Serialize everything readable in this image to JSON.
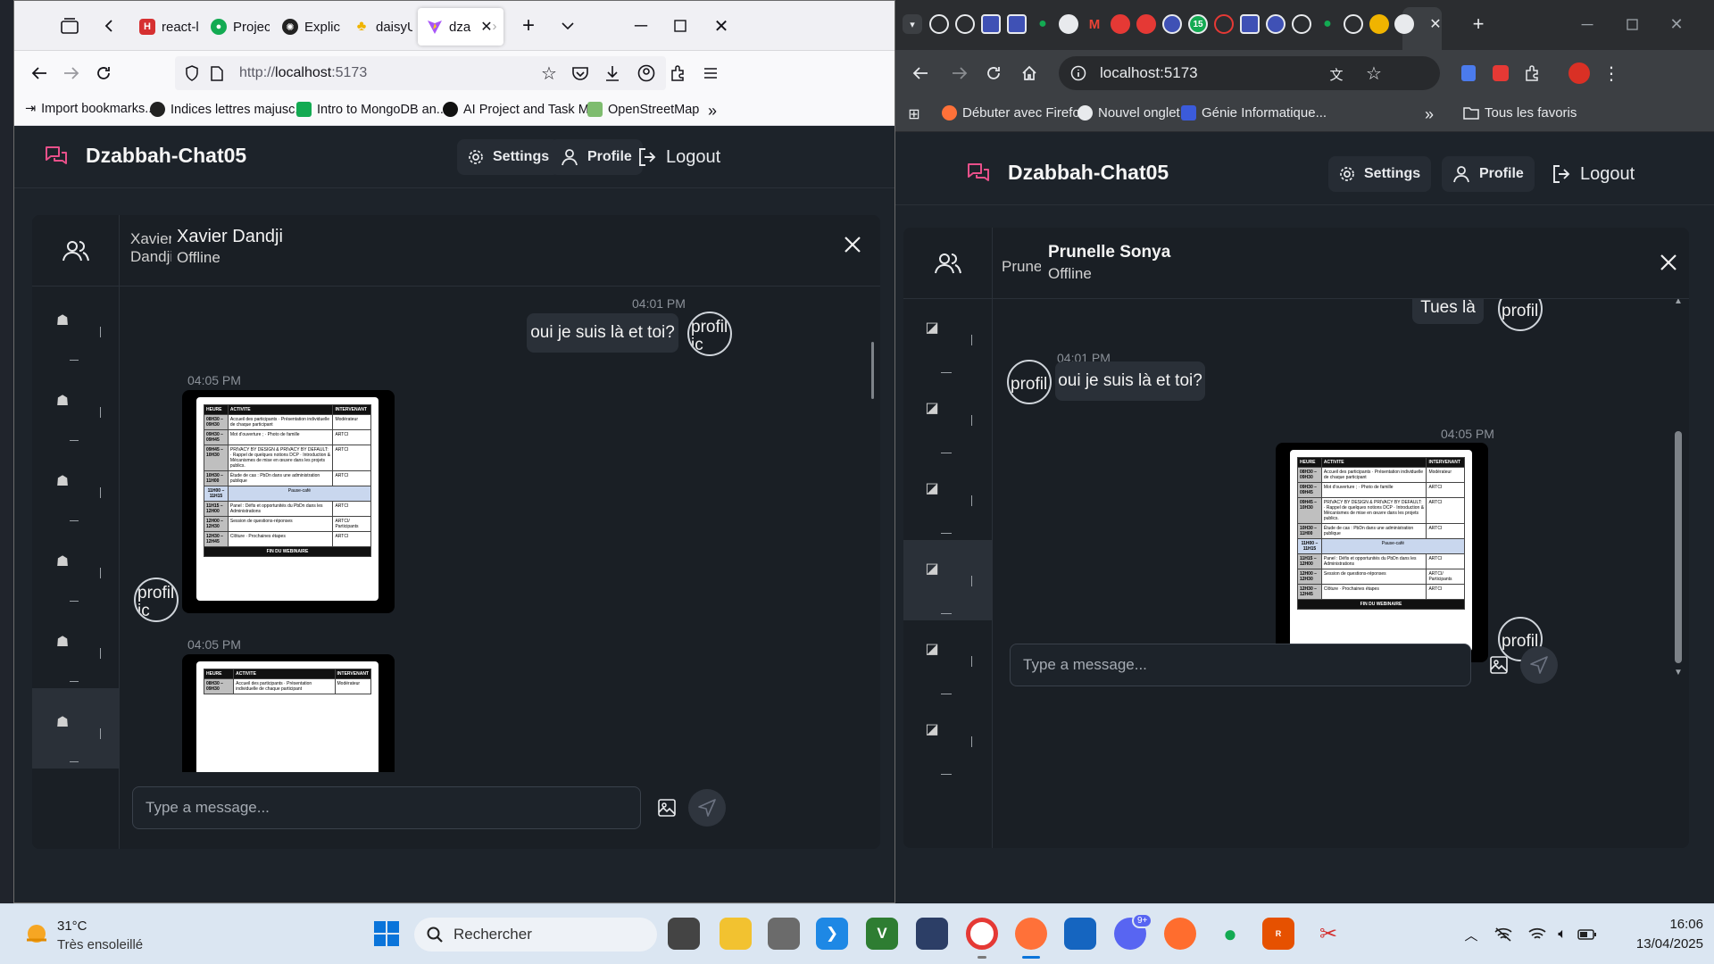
{
  "left_browser": {
    "tabs": [
      {
        "label": "react-l",
        "icon": "H"
      },
      {
        "label": "Projec",
        "icon": "mongodb-leaf"
      },
      {
        "label": "Explic",
        "icon": "openai"
      },
      {
        "label": "daisyU",
        "icon": "daisy"
      },
      {
        "label": "dza",
        "icon": "vite"
      }
    ],
    "url_prefix": "http://",
    "url_host": "localhost",
    "url_port": ":5173",
    "bookmarks": [
      "Import bookmarks...",
      "Indices lettres majusc...",
      "Intro to MongoDB an...",
      "AI Project and Task M...",
      "OpenStreetMap"
    ]
  },
  "right_browser": {
    "url": "localhost:5173",
    "bookmarks": [
      "Débuter avec Firefox",
      "Nouvel onglet",
      "Génie Informatique..."
    ],
    "all_bookmarks": "Tous les favoris"
  },
  "app": {
    "brand": "Dzabbah-Chat05",
    "settings_label": "Settings",
    "profile_label": "Profile",
    "logout_label": "Logout",
    "composer_placeholder": "Type a message...",
    "avatar_alt": "profil",
    "avatar_alt_tail": "ic"
  },
  "left_chat": {
    "contact_name": "Xavier Dandji",
    "contact_status": "Offline",
    "avatar_alt_line1": "Xavier",
    "avatar_alt_line2": "Dandji",
    "messages": [
      {
        "time": "04:01 PM",
        "text": "oui je suis là et toi?"
      },
      {
        "time": "04:05 PM"
      },
      {
        "time": "04:05 PM"
      }
    ]
  },
  "right_chat": {
    "contact_name": "Prunelle Sonya",
    "contact_status": "Offline",
    "avatar_alt": "Prune",
    "messages": [
      {
        "text": "Tues là"
      },
      {
        "time": "04:01 PM",
        "text": "oui je suis là et toi?"
      },
      {
        "time": "04:05 PM"
      }
    ]
  },
  "schedule_doc": {
    "headers": [
      "HEURE",
      "ACTIVITE",
      "INTERVENANT"
    ],
    "rows": [
      {
        "time": "08H30 – 09H30",
        "activity": "Accueil des participants · Présentation individuelle de chaque participant",
        "speaker": "Modérateur"
      },
      {
        "time": "09H30 – 09H45",
        "activity": "Mot d'ouverture ; · Photo de famille",
        "speaker": "ARTCI"
      },
      {
        "time": "09H45 – 10H30",
        "activity": "PRIVACY BY DESIGN & PRIVACY BY DEFAULT: · Rappel de quelques notions DCP · Introduction & Mécanismes de mise en œuvre dans les projets publics.",
        "speaker": "ARTCI"
      },
      {
        "time": "10H30 – 11H00",
        "activity": "Étude de cas : PbDn dans une administration publique",
        "speaker": "ARTCI"
      },
      {
        "time": "11H00 – 11H15",
        "activity": "Pause-café",
        "speaker": "",
        "pause": true
      },
      {
        "time": "11H15 – 12H00",
        "activity": "Panel : Défis et opportunités du PbDn dans les Administrations",
        "speaker": "ARTCI"
      },
      {
        "time": "12H00 – 12H30",
        "activity": "Session de questions-réponses",
        "speaker": "ARTCI/ Participants"
      },
      {
        "time": "12H30 – 12H45",
        "activity": "Clôture · Prochaines étapes",
        "speaker": "ARTCI"
      }
    ],
    "footer": "FIN DU WEBINAIRE"
  },
  "taskbar": {
    "temperature": "31°C",
    "weather": "Très ensoleillé",
    "search_placeholder": "Rechercher",
    "time": "16:06",
    "date": "13/04/2025",
    "discord_badge": "9+"
  },
  "colors": {
    "accent": "#e8508a",
    "app_bg": "#1d232a",
    "bubble": "#2a3038"
  }
}
